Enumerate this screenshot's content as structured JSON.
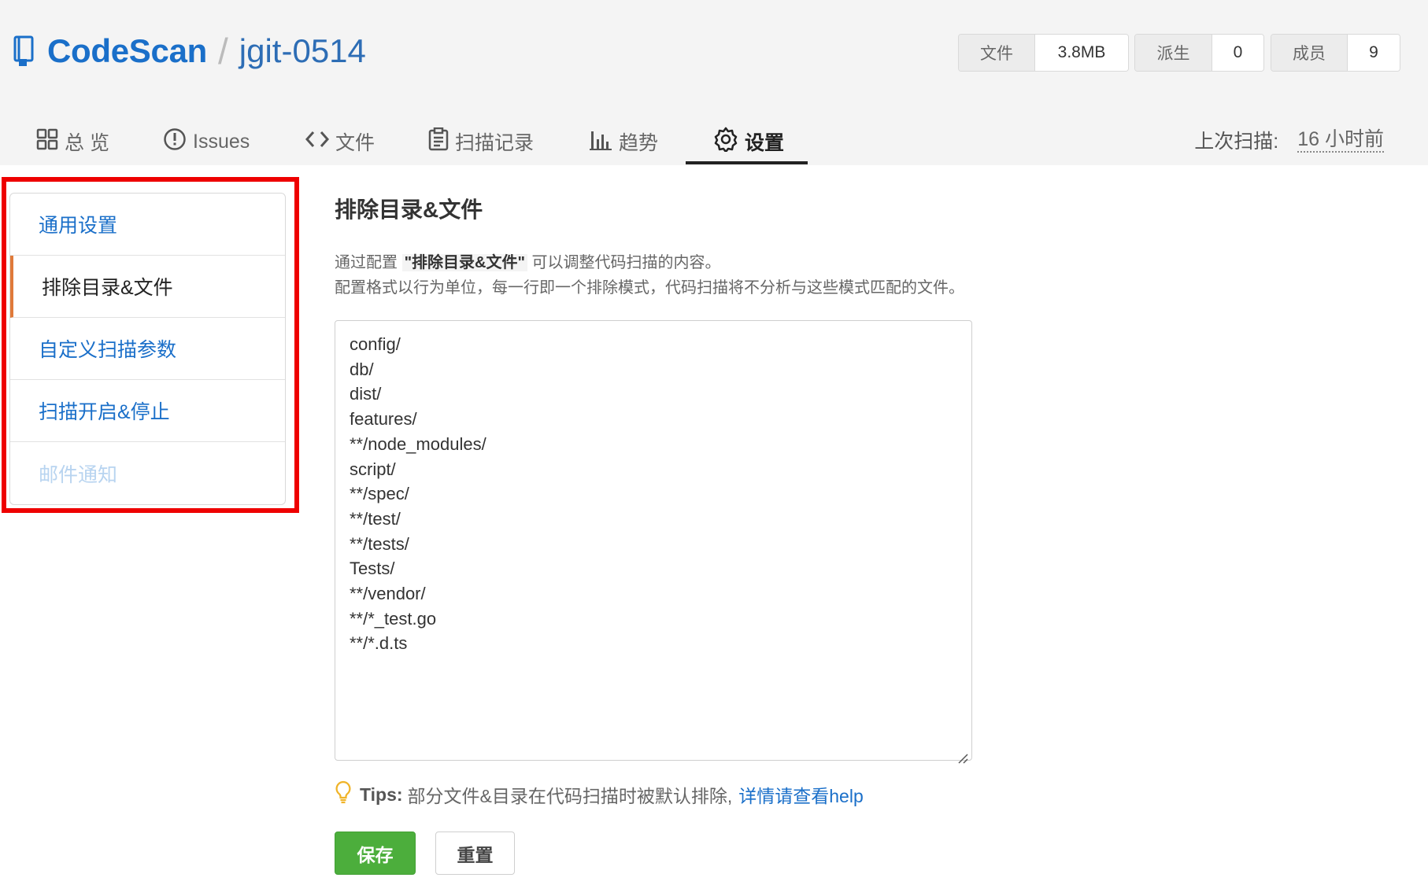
{
  "header": {
    "owner": "CodeScan",
    "separator": "/",
    "repo": "jgit-0514"
  },
  "stats": [
    {
      "label": "文件",
      "value": "3.8MB"
    },
    {
      "label": "派生",
      "value": "0"
    },
    {
      "label": "成员",
      "value": "9"
    }
  ],
  "tabs": [
    {
      "label": "总 览",
      "icon": "grid-icon"
    },
    {
      "label": "Issues",
      "icon": "alert-circle-icon"
    },
    {
      "label": "文件",
      "icon": "code-icon"
    },
    {
      "label": "扫描记录",
      "icon": "clipboard-icon"
    },
    {
      "label": "趋势",
      "icon": "bar-chart-icon"
    },
    {
      "label": "设置",
      "icon": "gear-icon",
      "active": true
    }
  ],
  "last_scan": {
    "label": "上次扫描:",
    "value": "16 小时前"
  },
  "sidebar": {
    "items": [
      {
        "label": "通用设置"
      },
      {
        "label": "排除目录&文件",
        "active": true
      },
      {
        "label": "自定义扫描参数"
      },
      {
        "label": "扫描开启&停止"
      },
      {
        "label": "邮件通知",
        "disabled": true
      }
    ]
  },
  "main": {
    "title": "排除目录&文件",
    "desc_prefix": "通过配置 ",
    "desc_bold": "\"排除目录&文件\"",
    "desc_suffix": " 可以调整代码扫描的内容。",
    "desc_line2": "配置格式以行为单位，每一行即一个排除模式，代码扫描将不分析与这些模式匹配的文件。",
    "patterns": [
      "config/",
      "db/",
      "dist/",
      "features/",
      "**/node_modules/",
      "script/",
      "**/spec/",
      "**/test/",
      "**/tests/",
      "Tests/",
      "**/vendor/",
      "**/*_test.go",
      "**/*.d.ts"
    ],
    "tips_label": "Tips:",
    "tips_text": "部分文件&目录在代码扫描时被默认排除,",
    "tips_link": "详情请查看help",
    "save_label": "保存",
    "reset_label": "重置"
  },
  "colors": {
    "accent_blue": "#1a6fc9",
    "save_green": "#4cae3c",
    "highlight_red": "#ee0000",
    "active_marker": "#e07a3a"
  }
}
